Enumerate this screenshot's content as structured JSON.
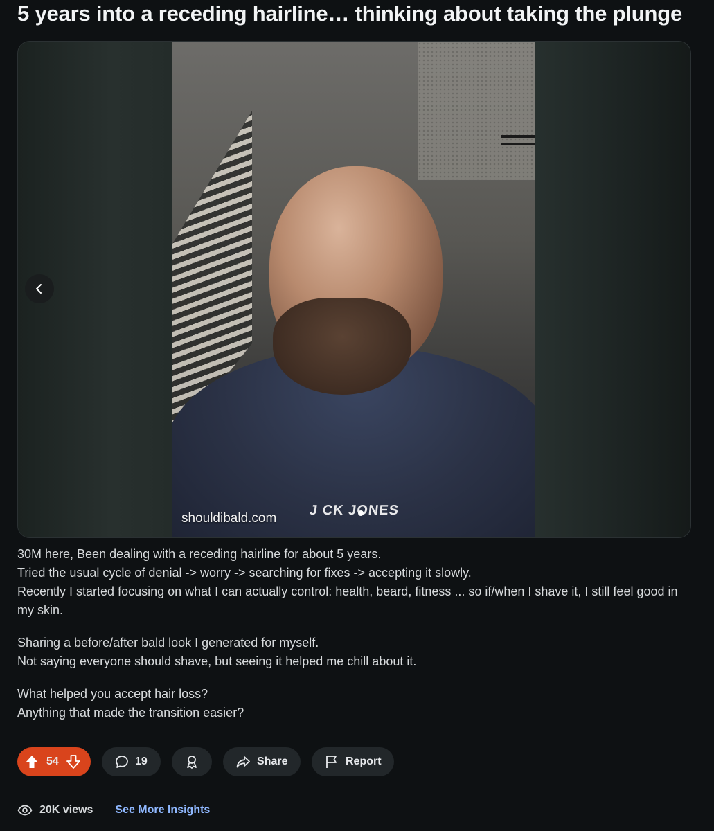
{
  "post": {
    "title": "5 years into a receding hairline… thinking about taking the plunge",
    "image": {
      "watermark": "shouldibald.com",
      "brand_text": "J CK JONES"
    },
    "body": [
      [
        "30M here, Been dealing with a receding hairline for about 5 years.",
        "Tried the usual cycle of denial -> worry -> searching for fixes -> accepting it slowly.",
        "Recently I started focusing on what I can actually control: health, beard, fitness ... so if/when I shave it, I still feel good in my skin."
      ],
      [
        "Sharing a before/after bald look I generated for myself.",
        "Not saying everyone should shave, but seeing it helped me chill about it."
      ],
      [
        "What helped you accept hair loss?",
        "Anything that made the transition easier?"
      ]
    ]
  },
  "actions": {
    "score": "54",
    "comments": "19",
    "share_label": "Share",
    "report_label": "Report"
  },
  "insights": {
    "views": "20K views",
    "link_label": "See More Insights"
  },
  "colors": {
    "background": "#0e1113",
    "vote_active": "#d9441c",
    "pill": "#22272a",
    "link": "#8fb8ff"
  },
  "icons": [
    "chevron-left-icon",
    "upvote-icon",
    "downvote-icon",
    "comment-icon",
    "award-icon",
    "share-icon",
    "report-flag-icon",
    "eye-icon"
  ]
}
